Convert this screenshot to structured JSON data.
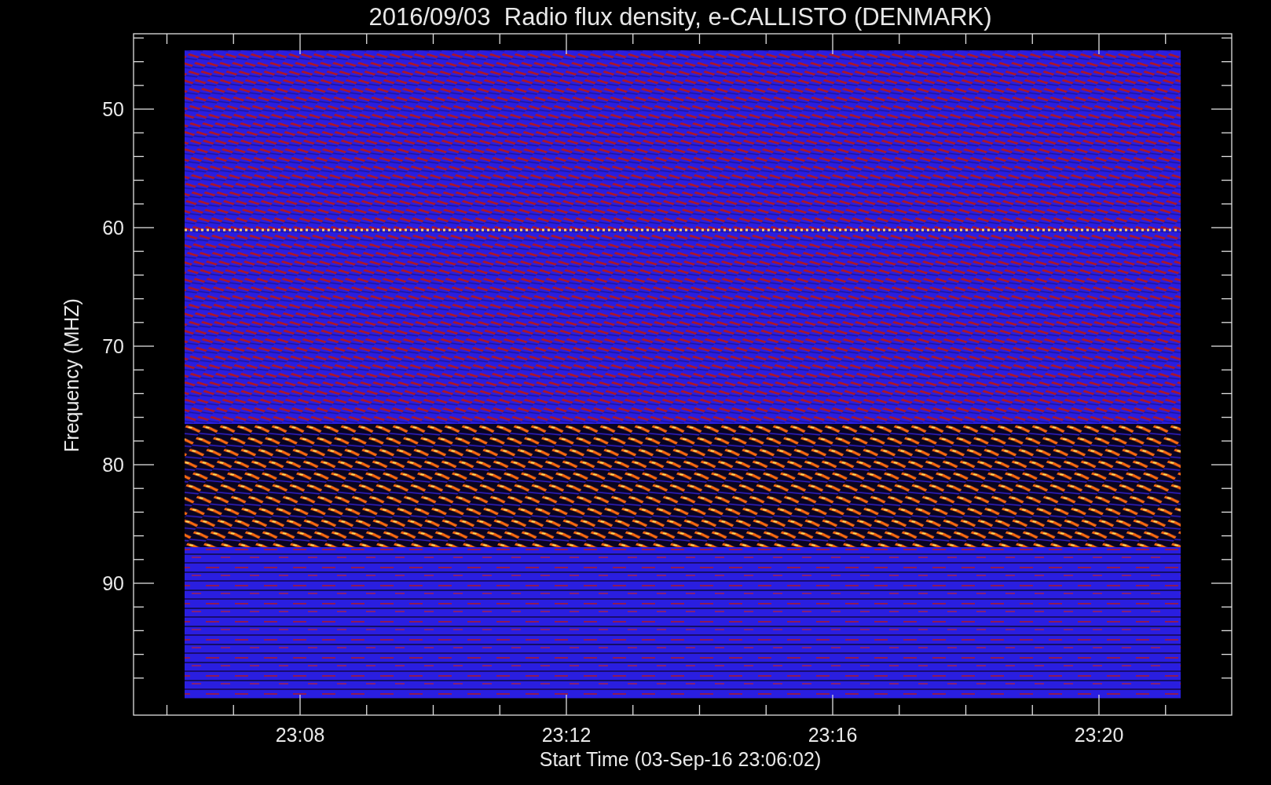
{
  "title": "2016/09/03  Radio flux density, e-CALLISTO (DENMARK)",
  "plot": {
    "ylabel": "Frequency (MHZ)",
    "xlabel": "Start Time (03-Sep-16 23:06:02)",
    "yticks": [
      "50",
      "60",
      "70",
      "80",
      "90"
    ],
    "xticks": [
      "23:08",
      "23:12",
      "23:16",
      "23:20"
    ]
  }
}
